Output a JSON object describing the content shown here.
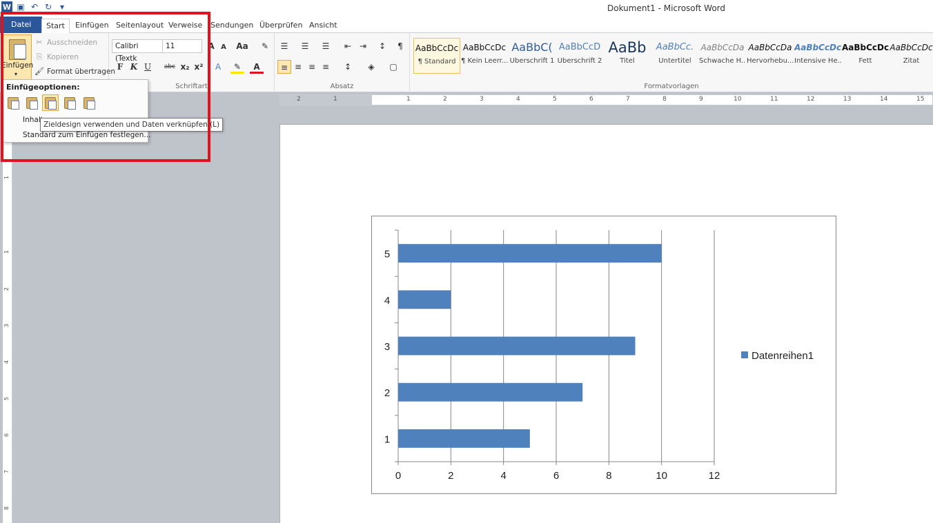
{
  "window": {
    "title": "Dokument1 - Microsoft Word"
  },
  "tabs": [
    {
      "label": "Datei"
    },
    {
      "label": "Start"
    },
    {
      "label": "Einfügen"
    },
    {
      "label": "Seitenlayout"
    },
    {
      "label": "Verweise"
    },
    {
      "label": "Sendungen"
    },
    {
      "label": "Überprüfen"
    },
    {
      "label": "Ansicht"
    }
  ],
  "clipboard": {
    "paste_label": "Einfügen",
    "cut_label": "Ausschneiden",
    "copy_label": "Kopieren",
    "format_painter_label": "Format übertragen"
  },
  "font": {
    "name": "Calibri (Textk",
    "size": "11",
    "group_label": "Schriftart",
    "bold": "F",
    "italic": "K",
    "underline": "U",
    "strike": "abc",
    "grow": "A",
    "shrink": "A",
    "case": "Aa"
  },
  "paragraph": {
    "group_label": "Absatz"
  },
  "styles": {
    "group_label": "Formatvorlagen",
    "items": [
      {
        "sample": "AaBbCcDc",
        "name": "¶ Standard"
      },
      {
        "sample": "AaBbCcDc",
        "name": "¶ Kein Leerr..."
      },
      {
        "sample": "AaBbC(",
        "name": "Überschrift 1"
      },
      {
        "sample": "AaBbCcD",
        "name": "Überschrift 2"
      },
      {
        "sample": "AaBb",
        "name": "Titel"
      },
      {
        "sample": "AaBbCc.",
        "name": "Untertitel"
      },
      {
        "sample": "AaBbCcDa",
        "name": "Schwache H..."
      },
      {
        "sample": "AaBbCcDa",
        "name": "Hervorhebu..."
      },
      {
        "sample": "AaBbCcDc",
        "name": "Intensive He..."
      },
      {
        "sample": "AaBbCcDc",
        "name": "Fett"
      },
      {
        "sample": "AaBbCcDc",
        "name": "Zitat"
      }
    ]
  },
  "paste_menu": {
    "heading": "Einfügeoptionen:",
    "item_1": "Inhalt",
    "item_2": "Standard zum Einfügen festlegen...",
    "tooltip": "Zieldesign verwenden und Daten verknüpfen (L)"
  },
  "ruler": {
    "h_ticks": [
      "2",
      "1",
      "1",
      "2",
      "3",
      "4",
      "5",
      "6",
      "7",
      "8",
      "9",
      "10",
      "11",
      "12",
      "13",
      "14",
      "15"
    ],
    "v_ticks": [
      "1",
      "1",
      "2",
      "3",
      "4",
      "5",
      "6",
      "7",
      "8"
    ]
  },
  "colors": {
    "accent": "#2b579a",
    "bar": "#4f81bd",
    "highlight": "#e0121b"
  },
  "chart_data": {
    "type": "bar",
    "orientation": "horizontal",
    "categories": [
      "1",
      "2",
      "3",
      "4",
      "5"
    ],
    "series": [
      {
        "name": "Datenreihen1",
        "values": [
          5,
          7,
          9,
          2,
          10
        ]
      }
    ],
    "xlim": [
      0,
      12
    ],
    "x_ticks": [
      "0",
      "2",
      "4",
      "6",
      "8",
      "10",
      "12"
    ],
    "grid": true,
    "legend": "right"
  }
}
